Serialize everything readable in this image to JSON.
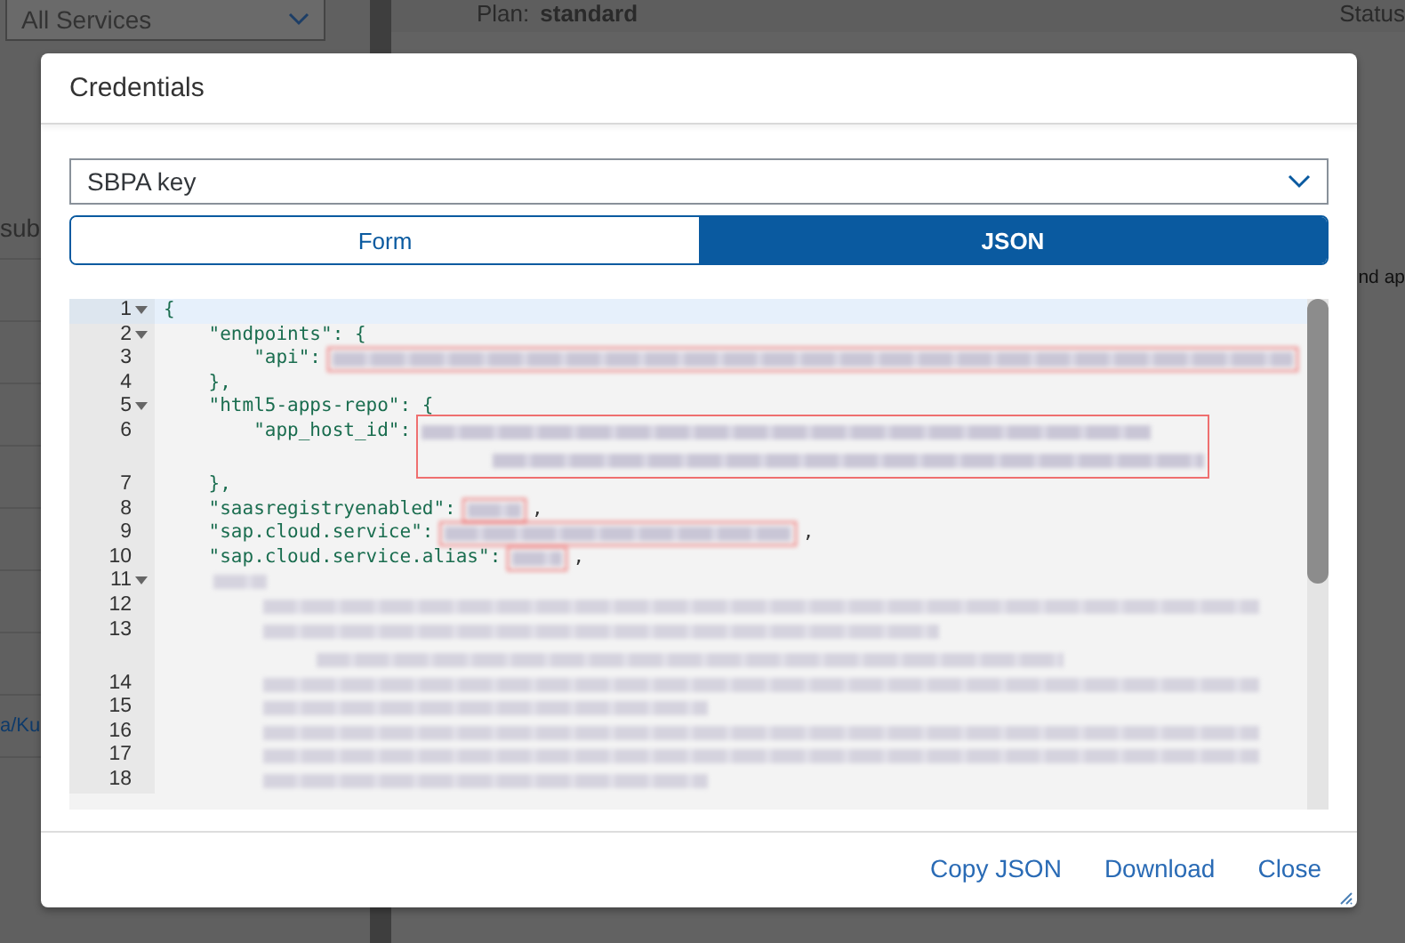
{
  "background": {
    "service_filter": "All Services",
    "plan_label": "Plan:",
    "plan_value": "standard",
    "status_label": "Status",
    "left_text": "sub",
    "right_text": "nd ap",
    "left_link": "a/Ku"
  },
  "dialog": {
    "title": "Credentials",
    "key_select": {
      "value": "SBPA key"
    },
    "view_tabs": [
      {
        "label": "Form",
        "selected": false
      },
      {
        "label": "JSON",
        "selected": true
      }
    ],
    "editor": {
      "lines": [
        {
          "number": "1",
          "foldable": true,
          "active": true,
          "kind": "plain",
          "code": "{"
        },
        {
          "number": "2",
          "foldable": true,
          "active": false,
          "kind": "plain",
          "code": "    \"endpoints\": {"
        },
        {
          "number": "3",
          "foldable": false,
          "active": false,
          "kind": "url",
          "code": "        \"api\": ",
          "highlighted": true
        },
        {
          "number": "4",
          "foldable": false,
          "active": false,
          "kind": "plain",
          "code": "    },"
        },
        {
          "number": "5",
          "foldable": true,
          "active": false,
          "kind": "plain",
          "code": "    \"html5-apps-repo\": {"
        },
        {
          "number": "6",
          "foldable": false,
          "active": false,
          "kind": "id",
          "code": "        \"app_host_id\": ",
          "highlighted": true
        },
        {
          "number": "7",
          "foldable": false,
          "active": false,
          "kind": "plain",
          "code": "    },"
        },
        {
          "number": "8",
          "foldable": false,
          "active": false,
          "kind": "bool",
          "code": "    \"saasregistryenabled\": ",
          "highlighted": true,
          "suffix": ","
        },
        {
          "number": "9",
          "foldable": false,
          "active": false,
          "kind": "service",
          "code": "    \"sap.cloud.service\": ",
          "highlighted": true,
          "suffix": ","
        },
        {
          "number": "10",
          "foldable": false,
          "active": false,
          "kind": "alias",
          "code": "    \"sap.cloud.service.alias\": ",
          "highlighted": true,
          "suffix": ","
        },
        {
          "number": "11",
          "foldable": true,
          "active": false,
          "kind": "section",
          "highlighted": false
        },
        {
          "number": "12",
          "foldable": false,
          "active": false,
          "kind": "entry",
          "highlighted": false
        },
        {
          "number": "13",
          "foldable": false,
          "active": false,
          "kind": "entry-wrap",
          "highlighted": false
        },
        {
          "number": "14",
          "foldable": false,
          "active": false,
          "kind": "entry",
          "highlighted": false
        },
        {
          "number": "15",
          "foldable": false,
          "active": false,
          "kind": "entry-short",
          "highlighted": false
        },
        {
          "number": "16",
          "foldable": false,
          "active": false,
          "kind": "entry",
          "highlighted": false
        },
        {
          "number": "17",
          "foldable": false,
          "active": false,
          "kind": "entry",
          "highlighted": false
        },
        {
          "number": "18",
          "foldable": false,
          "active": false,
          "kind": "entry-short",
          "highlighted": false
        }
      ]
    },
    "actions": [
      "Copy JSON",
      "Download",
      "Close"
    ]
  }
}
